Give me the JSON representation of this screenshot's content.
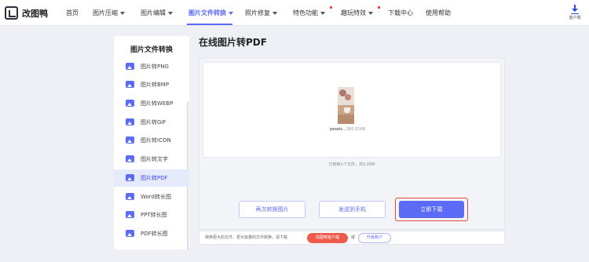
{
  "header": {
    "logo_text": "改图鸭",
    "nav": [
      {
        "label": "首页",
        "has_caret": false
      },
      {
        "label": "图片压缩",
        "has_caret": true
      },
      {
        "label": "图片编辑",
        "has_caret": true
      },
      {
        "label": "图片文件转换",
        "has_caret": true,
        "active": true
      },
      {
        "label": "照片修复",
        "has_caret": true
      },
      {
        "label": "特色功能",
        "has_caret": true,
        "badge": true
      },
      {
        "label": "趣玩特效",
        "has_caret": true,
        "badge": true
      },
      {
        "label": "下载中心",
        "has_caret": false
      },
      {
        "label": "使用帮助",
        "has_caret": false
      }
    ],
    "client_download_label": "客户端"
  },
  "sidebar": {
    "title": "图片文件转换",
    "items": [
      {
        "label": "图片转PNG"
      },
      {
        "label": "图片转BMP"
      },
      {
        "label": "图片转WEBP"
      },
      {
        "label": "图片转GIF"
      },
      {
        "label": "图片转ICON"
      },
      {
        "label": "图片转文字"
      },
      {
        "label": "图片转PDF",
        "active": true
      },
      {
        "label": "Word转长图"
      },
      {
        "label": "PPT转长图"
      },
      {
        "label": "PDF转长图"
      }
    ]
  },
  "main": {
    "title": "在线图片转PDF",
    "file": {
      "name": "pexels...",
      "size": "390.81KB"
    },
    "summary": "已转换1个文件，共0.35M",
    "buttons": {
      "reconvert": "再次转换图片",
      "send_phone": "发送到手机",
      "download": "立即下载"
    },
    "info_bar": {
      "text": "转换更大的文件、更大批量的文件转换，请下载",
      "client_pill": "改图鸭客户端",
      "or": "或",
      "upgrade_pill": "升级账户"
    }
  },
  "colors": {
    "accent": "#5b6bf5",
    "highlight": "#e04a3a",
    "badge": "#e84a3a"
  }
}
